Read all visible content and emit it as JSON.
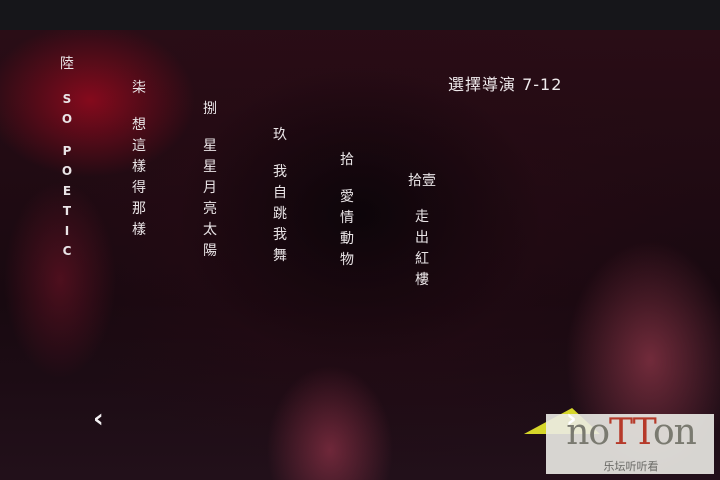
{
  "menu": {
    "header": "選擇導演 7-12",
    "chapters": [
      {
        "number": "陸",
        "title": [
          "S",
          "O",
          "P",
          "O",
          "E",
          "T",
          "I",
          "C"
        ],
        "latin": true
      },
      {
        "number": "柒",
        "title": [
          "想",
          "這",
          "樣",
          "得",
          "那",
          "樣"
        ],
        "latin": false
      },
      {
        "number": "捌",
        "title": [
          "星",
          "星",
          "月",
          "亮",
          "太",
          "陽"
        ],
        "latin": false
      },
      {
        "number": "玖",
        "title": [
          "我",
          "自",
          "跳",
          "我",
          "舞"
        ],
        "latin": false
      },
      {
        "number": "拾",
        "title": [
          "愛",
          "情",
          "動",
          "物"
        ],
        "latin": false
      },
      {
        "number": "拾壹",
        "title": [
          "走",
          "出",
          "紅",
          "樓"
        ],
        "latin": false
      }
    ],
    "prev_symbol": "‹",
    "next_symbol": "›"
  },
  "watermark": {
    "brand_parts": [
      "no",
      "TT",
      "on"
    ],
    "subtitle": "乐坛听听看"
  }
}
